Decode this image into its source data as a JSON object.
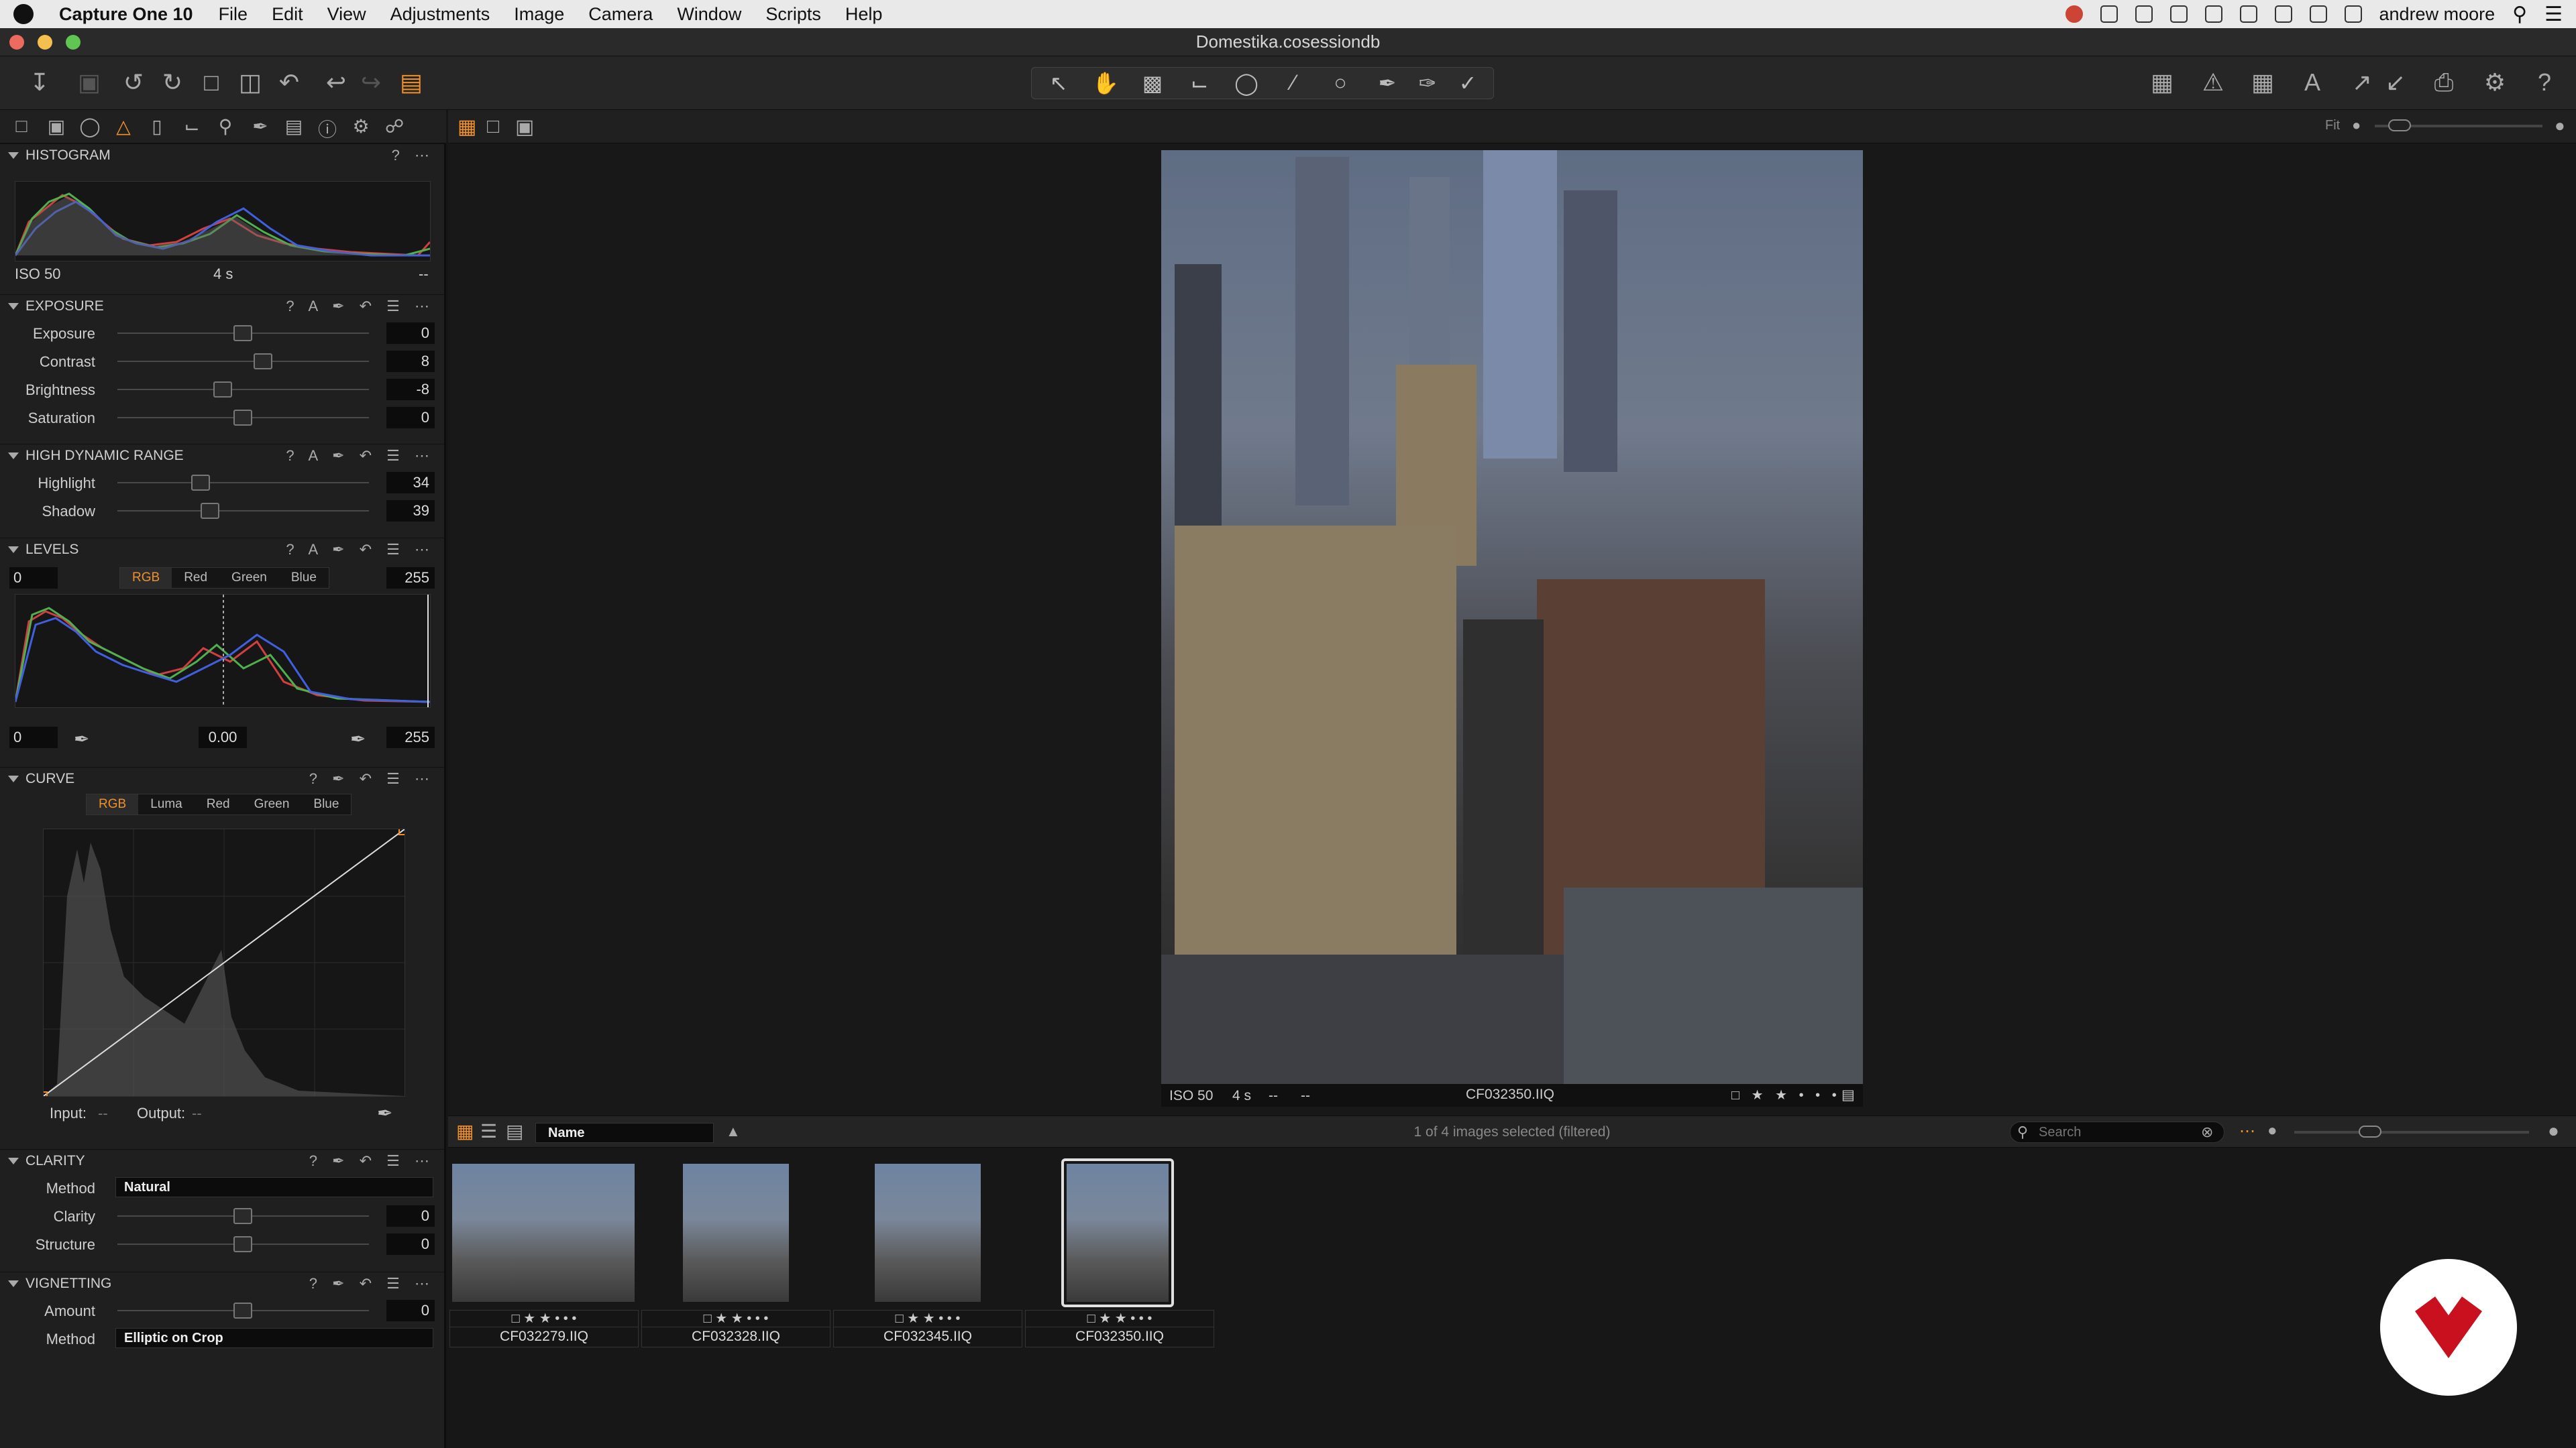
{
  "menubar": {
    "app": "Capture One 10",
    "items": [
      "File",
      "Edit",
      "View",
      "Adjustments",
      "Image",
      "Camera",
      "Window",
      "Scripts",
      "Help"
    ],
    "user": "andrew moore"
  },
  "window": {
    "title": "Domestika.cosessiondb"
  },
  "histogram": {
    "title": "HISTOGRAM",
    "iso": "ISO 50",
    "shutter": "4 s",
    "aperture": "--"
  },
  "exposure": {
    "title": "EXPOSURE",
    "sliders": [
      {
        "label": "Exposure",
        "value": "0",
        "pos": 0.5
      },
      {
        "label": "Contrast",
        "value": "8",
        "pos": 0.58
      },
      {
        "label": "Brightness",
        "value": "-8",
        "pos": 0.42
      },
      {
        "label": "Saturation",
        "value": "0",
        "pos": 0.5
      }
    ]
  },
  "hdr": {
    "title": "HIGH DYNAMIC RANGE",
    "sliders": [
      {
        "label": "Highlight",
        "value": "34",
        "pos": 0.34
      },
      {
        "label": "Shadow",
        "value": "39",
        "pos": 0.37
      }
    ]
  },
  "levels": {
    "title": "LEVELS",
    "input_low": "0",
    "input_high": "255",
    "channels": [
      "RGB",
      "Red",
      "Green",
      "Blue"
    ],
    "output_low": "0",
    "gamma": "0.00",
    "output_high": "255"
  },
  "curve": {
    "title": "CURVE",
    "channels": [
      "RGB",
      "Luma",
      "Red",
      "Green",
      "Blue"
    ],
    "input_label": "Input:",
    "input_value": "--",
    "output_label": "Output:",
    "output_value": "--"
  },
  "clarity": {
    "title": "CLARITY",
    "method_label": "Method",
    "method": "Natural",
    "sliders": [
      {
        "label": "Clarity",
        "value": "0",
        "pos": 0.5
      },
      {
        "label": "Structure",
        "value": "0",
        "pos": 0.5
      }
    ]
  },
  "vignetting": {
    "title": "VIGNETTING",
    "amount_label": "Amount",
    "amount": "0",
    "amount_pos": 0.5,
    "method_label": "Method",
    "method": "Elliptic on Crop"
  },
  "viewer": {
    "fit_label": "Fit",
    "iso": "ISO 50",
    "shutter": "4 s",
    "aperture": "--",
    "focal": "--",
    "filename": "CF032350.IIQ"
  },
  "browser": {
    "sort": "Name",
    "status": "1 of 4 images selected (filtered)",
    "search_placeholder": "Search",
    "thumbnails": [
      {
        "name": "CF032279.IIQ",
        "selected": false
      },
      {
        "name": "CF032328.IIQ",
        "selected": false
      },
      {
        "name": "CF032345.IIQ",
        "selected": false
      },
      {
        "name": "CF032350.IIQ",
        "selected": true
      }
    ]
  },
  "colors": {
    "accent": "#f0902a",
    "histRed": "#d04040",
    "histGreen": "#50b050",
    "histBlue": "#4060e0",
    "brand": "#c8101e"
  },
  "icons": [
    "apple-icon",
    "import-icon",
    "camera-icon",
    "rotate-left-icon",
    "rotate-right-icon",
    "move-icon",
    "trash-icon",
    "undo-icon",
    "redo-icon",
    "variant-icon",
    "select-cursor-icon",
    "pan-icon",
    "crop-icon",
    "straighten-icon",
    "keystone-icon",
    "spot-icon",
    "brush-icon",
    "erase-icon",
    "picker-icon",
    "grid-icon",
    "warning-icon",
    "exposure-warning-icon",
    "text-icon",
    "print-icon",
    "gear-icon",
    "help-icon",
    "search-icon",
    "star-icon"
  ]
}
